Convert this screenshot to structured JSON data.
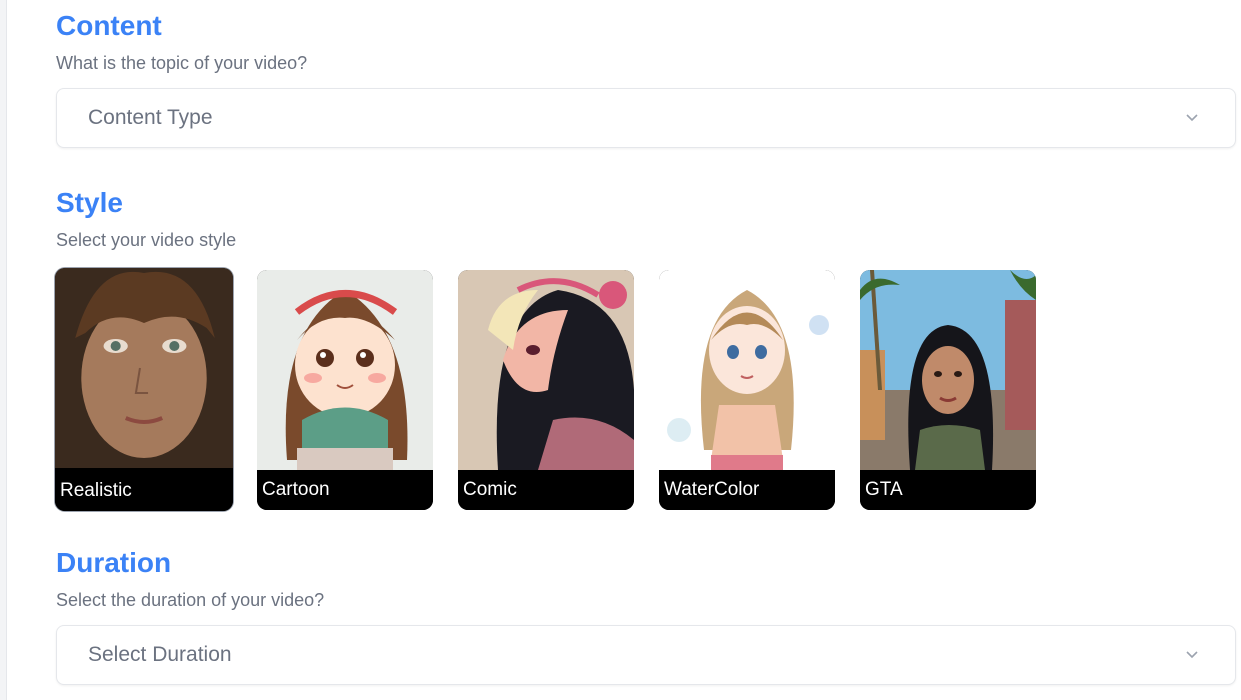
{
  "content": {
    "heading": "Content",
    "question": "What is the topic of your video?",
    "select_placeholder": "Content Type"
  },
  "style": {
    "heading": "Style",
    "question": "Select your video style",
    "options": [
      {
        "label": "Realistic",
        "selected": true
      },
      {
        "label": "Cartoon",
        "selected": false
      },
      {
        "label": "Comic",
        "selected": false
      },
      {
        "label": "WaterColor",
        "selected": false
      },
      {
        "label": "GTA",
        "selected": false
      }
    ]
  },
  "duration": {
    "heading": "Duration",
    "question": "Select the duration of your video?",
    "select_placeholder": "Select Duration"
  },
  "icons": {
    "dropdown": "chevron-down-icon"
  },
  "colors": {
    "heading": "#3b82f6",
    "subtext": "#6b7280",
    "label_bg": "#000000"
  }
}
